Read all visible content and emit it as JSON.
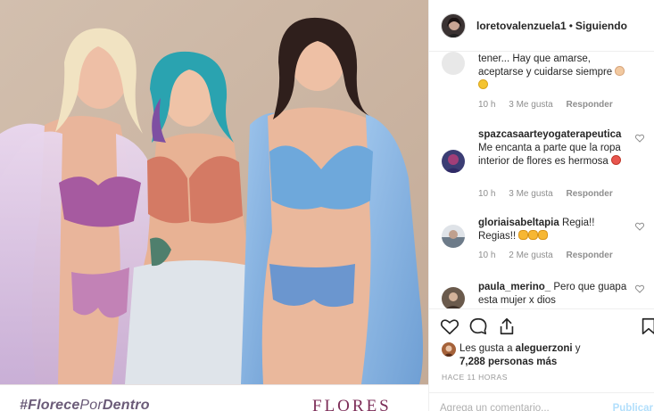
{
  "media": {
    "hashtag_bold": "#Florece",
    "hashtag_mid": "Por",
    "hashtag_end": "Dentro",
    "brand": "FLORES"
  },
  "header": {
    "username": "loretovalenzuela1",
    "separator": "•",
    "follow_label": "Siguiendo"
  },
  "comments": [
    {
      "user": "",
      "text": "tener... Hay que amarse, aceptarse y cuidarse siempre",
      "time": "10 h",
      "likes": "3 Me gusta",
      "reply": "Responder"
    },
    {
      "user": "spazcasaarteyogaterapeutica",
      "text": "Me encanta a parte que la ropa interior de flores es hermosa",
      "time": "10 h",
      "likes": "3 Me gusta",
      "reply": "Responder"
    },
    {
      "user": "gloriaisabeltapia",
      "text": "Regia!! Regias!!",
      "time": "10 h",
      "likes": "2 Me gusta",
      "reply": "Responder"
    },
    {
      "user": "paula_merino_",
      "text": "Pero que guapa esta mujer x dios",
      "time": "",
      "likes": "",
      "reply": ""
    }
  ],
  "likes": {
    "prefix": "Les gusta a",
    "user": "aleguerzoni",
    "mid": "y",
    "count": "7,288 personas más"
  },
  "time_ago": "HACE 11 HORAS",
  "add_comment": {
    "placeholder": "Agrega un comentario...",
    "publish_label": "Publicar"
  },
  "colors": {
    "text": "#262626",
    "muted": "#8e8e8e",
    "publish": "#b2dffc",
    "brand": "#7c2d58",
    "hashtag": "#6b5b78"
  }
}
